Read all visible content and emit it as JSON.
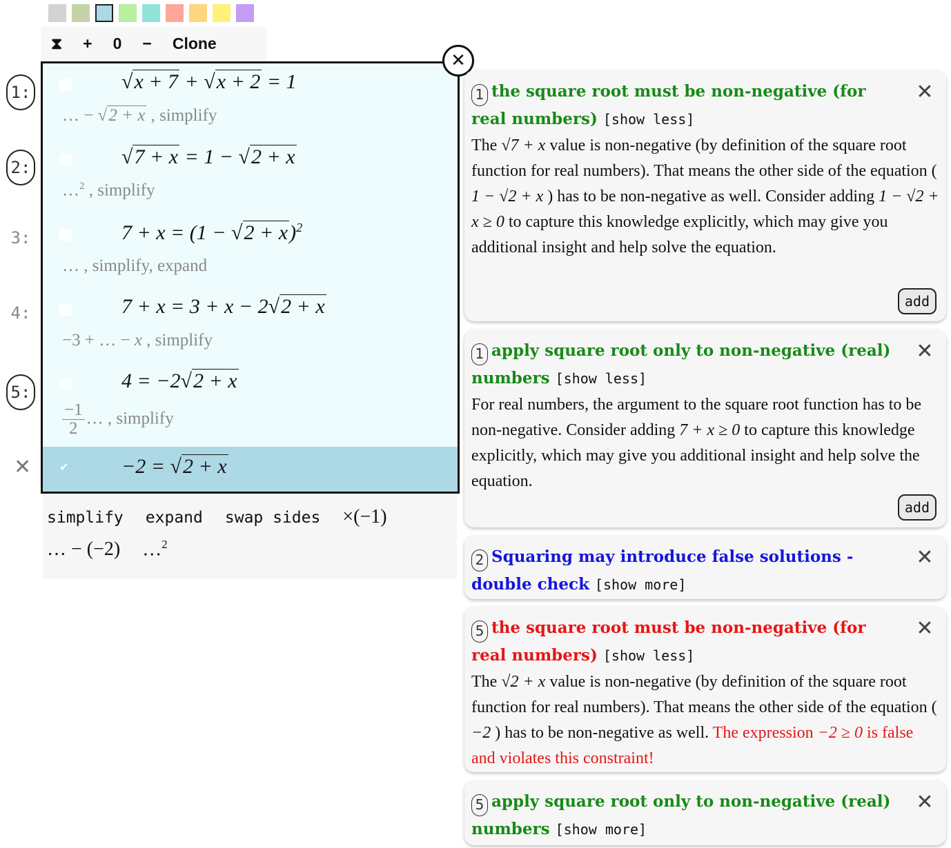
{
  "palette": {
    "colors": [
      "#d3d3d3",
      "#c5d3a8",
      "#add8e6",
      "#b6f0a0",
      "#8fe3d9",
      "#ffa69b",
      "#ffd580",
      "#fff27a",
      "#c59cf5"
    ],
    "selected_index": 2
  },
  "toolbar": {
    "sigma": "⧗",
    "plus": "+",
    "zero": "0",
    "minus": "−",
    "clone": "Clone"
  },
  "gutter": {
    "lines": [
      "1:",
      "2:",
      "3:",
      "4:",
      "5:"
    ],
    "remove": "✕"
  },
  "derivation": {
    "close": "✕",
    "steps": [
      {
        "op": "…",
        "eq": "√x + 7 + √x + 2 = 1"
      },
      {
        "op": "… − √2 + x , simplify",
        "eq": "√7 + x = 1 − √2 + x"
      },
      {
        "op": "…² , simplify",
        "eq": "7 + x = (1 − √2 + x)²"
      },
      {
        "op": "… , simplify, expand",
        "eq": "7 + x = 3 + x − 2√2 + x"
      },
      {
        "op": "−3 + … − x , simplify",
        "eq": "4 = −2√2 + x"
      },
      {
        "op": "−1/2 … , simplify",
        "eq": "−2 = √2 + x"
      }
    ],
    "checkmark": "✔"
  },
  "operations": {
    "row1": [
      "simplify",
      "expand",
      "swap sides",
      "×(−1)"
    ],
    "row2": [
      "… − (−2)",
      "…²"
    ]
  },
  "hints": [
    {
      "badge": "1",
      "title": "the square root must be non-negative (for real numbers)",
      "toggle": "[show less]",
      "close": "✕",
      "body": [
        "The ",
        "√7 + x",
        " value is non-negative (by definition of the square root function for real numbers). That means the other side of the equation ( ",
        "1 − √2 + x",
        " ) has to be non-negative as well. Consider adding ",
        "1 − √2 + x ≥ 0",
        " to capture this knowledge explicitly, which may give you additional insight and help solve the equation."
      ],
      "add": "add"
    },
    {
      "badge": "1",
      "title": "apply square root only to non-negative (real) numbers",
      "toggle": "[show less]",
      "close": "✕",
      "body": [
        "For real numbers, the argument to the square root function has to be non-negative. Consider adding ",
        "7 + x ≥ 0",
        " to capture this knowledge explicitly, which may give you additional insight and help solve the equation."
      ],
      "add": "add"
    },
    {
      "badge": "2",
      "title": "Squaring may introduce false solutions - double check",
      "toggle": "[show more]",
      "close": "✕"
    },
    {
      "badge": "5",
      "title": "the square root must be non-negative (for real numbers)",
      "toggle": "[show less]",
      "close": "✕",
      "body": [
        "The ",
        "√2 + x",
        " value is non-negative (by definition of the square root function for real numbers). That means the other side of the equation ( ",
        "−2",
        " ) has to be non-negative as well. "
      ],
      "body_red": [
        "The expression ",
        "−2 ≥ 0",
        " is false and violates this constraint!"
      ]
    },
    {
      "badge": "5",
      "title": "apply square root only to non-negative (real) numbers",
      "toggle": "[show more]",
      "close": "✕"
    }
  ]
}
